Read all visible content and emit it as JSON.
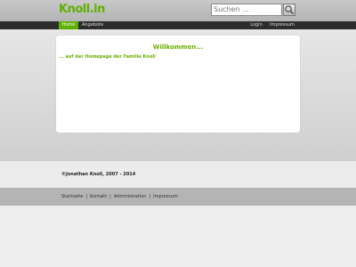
{
  "header": {
    "logo": "Knoll.in",
    "search_placeholder": "Suchen ...",
    "search_icon": "magnifier-icon"
  },
  "nav": {
    "left": [
      "Home",
      "Angebote"
    ],
    "right": [
      "Login",
      "Impressum"
    ],
    "active": "Home"
  },
  "content": {
    "title": "Willkommen...",
    "subtitle": "... auf der Homepage der Familie Knoll"
  },
  "footer": {
    "copyright": "©Jonathan Knoll, 2007 - 2014",
    "links": [
      "Startseite",
      "Kontakt",
      "Administration",
      "Impressum"
    ]
  },
  "colors": {
    "accent": "#5fb000",
    "navbar": "#2c2c2c"
  }
}
